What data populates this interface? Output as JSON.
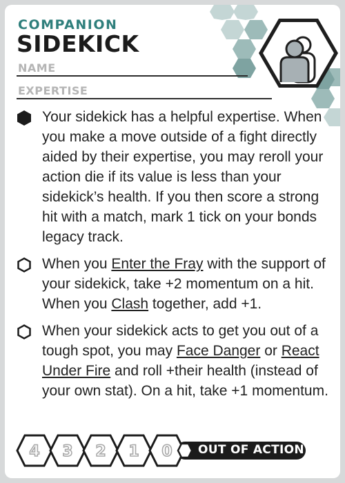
{
  "card": {
    "category": "COMPANION",
    "title": "SIDEKICK",
    "fields": {
      "name_label": "NAME",
      "expertise_label": "EXPERTISE"
    }
  },
  "abilities": [
    {
      "state": "filled",
      "segments": [
        {
          "text": "Your sidekick has a helpful expertise. When you make a move outside of a fight directly aided by their expertise, you may reroll your action die if its value is less than your sidekick’s health. If you then score a strong hit with a match, mark 1 tick on your bonds legacy track.",
          "u": false
        }
      ]
    },
    {
      "state": "empty",
      "segments": [
        {
          "text": "When you ",
          "u": false
        },
        {
          "text": "Enter the Fray",
          "u": true
        },
        {
          "text": " with the support of your sidekick, take +2 momentum on a hit. When you ",
          "u": false
        },
        {
          "text": "Clash",
          "u": true
        },
        {
          "text": " together, add +1.",
          "u": false
        }
      ]
    },
    {
      "state": "empty",
      "segments": [
        {
          "text": "When your sidekick acts to get you out of a tough spot, you may ",
          "u": false
        },
        {
          "text": "Face Danger",
          "u": true
        },
        {
          "text": " or ",
          "u": false
        },
        {
          "text": "React Under Fire",
          "u": true
        },
        {
          "text": " and roll +their health (instead of your own stat). On a hit, take +1 momentum.",
          "u": false
        }
      ]
    }
  ],
  "health_track": {
    "values": [
      "4",
      "3",
      "2",
      "1",
      "0"
    ],
    "end_label": "OUT OF ACTION"
  },
  "colors": {
    "accent": "#2f7f7c",
    "hex_light": "#b9cecd",
    "hex_mid": "#8fb0ae",
    "text": "#222222"
  },
  "icons": {
    "portrait": "companion-portrait-icon"
  }
}
